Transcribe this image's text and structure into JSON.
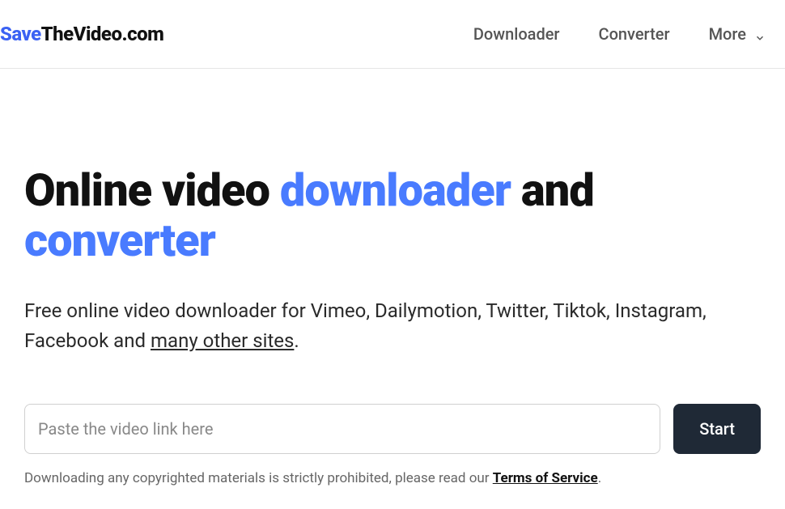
{
  "logo": {
    "part1": "Save",
    "part2": "TheVideo",
    "part3": ".com"
  },
  "nav": {
    "downloader": "Downloader",
    "converter": "Converter",
    "more": "More"
  },
  "hero": {
    "title_part1": "Online video ",
    "title_accent1": "downloader",
    "title_part2": " and ",
    "title_accent2": "converter",
    "subtitle_part1": "Free online video downloader for Vimeo, Dailymotion, Twitter, Tiktok, Instagram, Facebook and ",
    "subtitle_link": "many other sites",
    "subtitle_part2": "."
  },
  "form": {
    "placeholder": "Paste the video link here",
    "start_label": "Start"
  },
  "disclaimer": {
    "text": "Downloading any copyrighted materials is strictly prohibited, please read our ",
    "link": "Terms of Service",
    "suffix": "."
  }
}
